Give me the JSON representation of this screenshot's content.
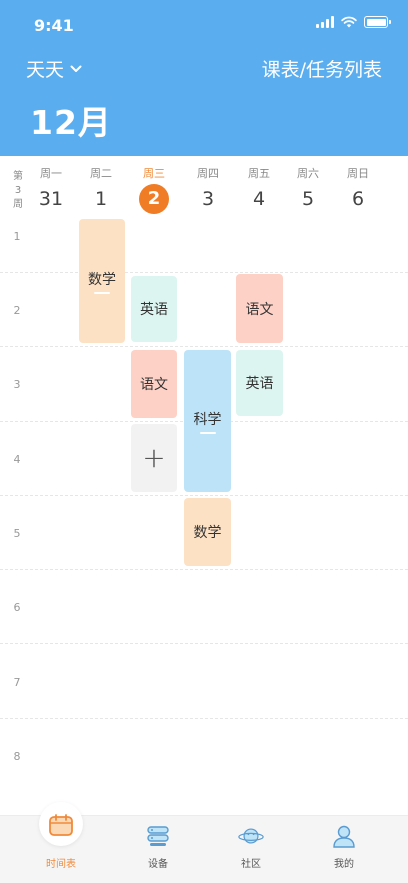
{
  "status": {
    "time": "9:41"
  },
  "header": {
    "user": "天天",
    "list_link": "课表/任务列表",
    "month": "12月"
  },
  "week": {
    "label_chars": [
      "第",
      "3",
      "周"
    ],
    "days": [
      {
        "name": "周一",
        "num": "31",
        "active": false
      },
      {
        "name": "周二",
        "num": "1",
        "active": false
      },
      {
        "name": "周三",
        "num": "2",
        "active": true
      },
      {
        "name": "周四",
        "num": "3",
        "active": false
      },
      {
        "name": "周五",
        "num": "4",
        "active": false
      },
      {
        "name": "周六",
        "num": "5",
        "active": false
      },
      {
        "name": "周日",
        "num": "6",
        "active": false
      }
    ]
  },
  "periods": [
    "1",
    "2",
    "3",
    "4",
    "5",
    "6",
    "7",
    "8"
  ],
  "courses": [
    {
      "name": "数学",
      "day": "周二",
      "from_period": 1,
      "to_period": 2,
      "color": "#fde1c4",
      "current": true
    },
    {
      "name": "英语",
      "day": "周三",
      "from_period": 2,
      "to_period": 2,
      "color": "#ddf5f0",
      "current": false
    },
    {
      "name": "语文",
      "day": "周五",
      "from_period": 2,
      "to_period": 2,
      "color": "#fdd1c6",
      "current": false
    },
    {
      "name": "语文",
      "day": "周三",
      "from_period": 3,
      "to_period": 3,
      "color": "#fdd1c6",
      "current": false
    },
    {
      "name": "英语",
      "day": "周五",
      "from_period": 3,
      "to_period": 3,
      "color": "#ddf5f0",
      "current": false
    },
    {
      "name": "科学",
      "day": "周四",
      "from_period": 3,
      "to_period": 4,
      "color": "#bde3f8",
      "current": true
    },
    {
      "name": "数学",
      "day": "周四",
      "from_period": 5,
      "to_period": 5,
      "color": "#fde1c4",
      "current": false
    }
  ],
  "add_button": {
    "symbol": "+",
    "day": "周三",
    "period": 4
  },
  "tabbar": {
    "tabs": [
      {
        "label": "时间表",
        "icon": "calendar-icon",
        "active": true
      },
      {
        "label": "设备",
        "icon": "device-icon",
        "active": false
      },
      {
        "label": "社区",
        "icon": "planet-icon",
        "active": false
      },
      {
        "label": "我的",
        "icon": "user-icon",
        "active": false
      }
    ]
  },
  "colors": {
    "header": "#5aaeef",
    "accent": "#f07c25"
  }
}
